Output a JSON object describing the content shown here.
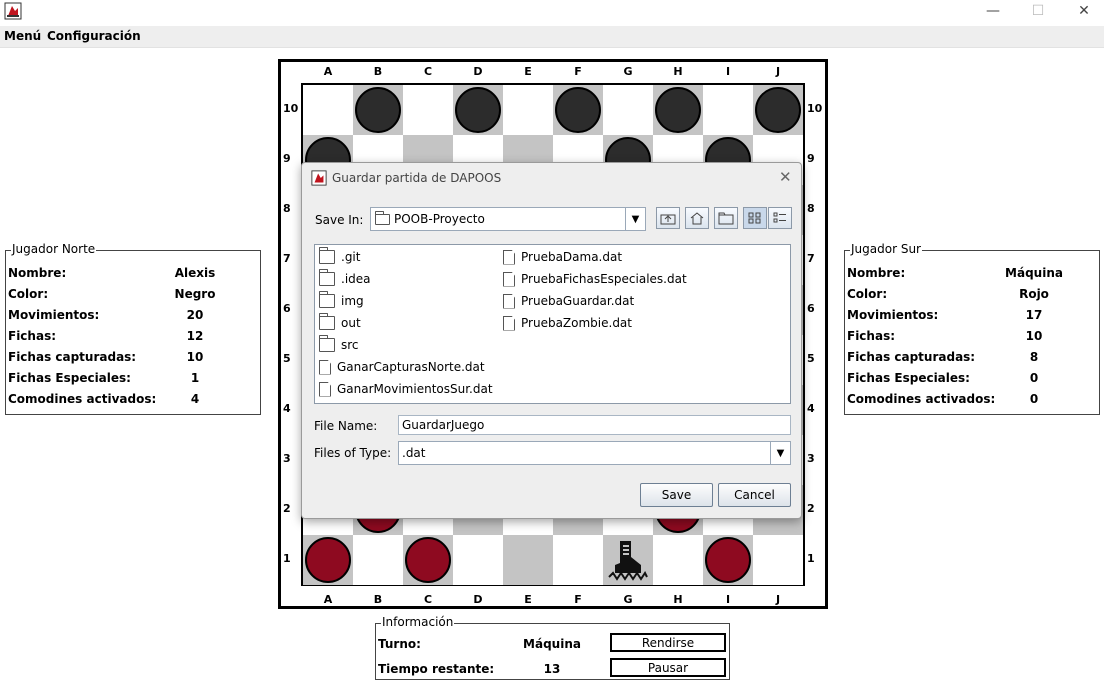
{
  "window": {
    "minimize": "—",
    "maximize": "☐",
    "close": "✕"
  },
  "menubar": {
    "items": [
      "Menú",
      "Configuración"
    ]
  },
  "board": {
    "columns": [
      "A",
      "B",
      "C",
      "D",
      "E",
      "F",
      "G",
      "H",
      "I",
      "J"
    ],
    "rows": [
      "10",
      "9",
      "8",
      "7",
      "6",
      "5",
      "4",
      "3",
      "2",
      "1"
    ],
    "pieces": [
      {
        "row": "10",
        "col": "B",
        "color": "black"
      },
      {
        "row": "10",
        "col": "D",
        "color": "black"
      },
      {
        "row": "10",
        "col": "F",
        "color": "black"
      },
      {
        "row": "10",
        "col": "H",
        "color": "black"
      },
      {
        "row": "10",
        "col": "J",
        "color": "black"
      },
      {
        "row": "9",
        "col": "A",
        "color": "black"
      },
      {
        "row": "9",
        "col": "G",
        "color": "black"
      },
      {
        "row": "9",
        "col": "I",
        "color": "black"
      },
      {
        "row": "2",
        "col": "B",
        "color": "red"
      },
      {
        "row": "2",
        "col": "H",
        "color": "red"
      },
      {
        "row": "1",
        "col": "A",
        "color": "red"
      },
      {
        "row": "1",
        "col": "C",
        "color": "red"
      },
      {
        "row": "1",
        "col": "I",
        "color": "red"
      },
      {
        "row": "1",
        "col": "G",
        "color": "zombie"
      }
    ],
    "colors": {
      "dark_square": "#c4c4c4",
      "black_piece": "#2c2c2c",
      "red_piece": "#8e0a20"
    }
  },
  "dialog": {
    "title": "Guardar partida de DAPOOS",
    "save_in_label": "Save In:",
    "save_in_value": "POOB-Proyecto",
    "files": [
      {
        "name": ".git",
        "type": "folder"
      },
      {
        "name": ".idea",
        "type": "folder"
      },
      {
        "name": "img",
        "type": "folder"
      },
      {
        "name": "out",
        "type": "folder"
      },
      {
        "name": "src",
        "type": "folder"
      },
      {
        "name": "GanarCapturasNorte.dat",
        "type": "file"
      },
      {
        "name": "GanarMovimientosSur.dat",
        "type": "file"
      },
      {
        "name": "PruebaDama.dat",
        "type": "file"
      },
      {
        "name": "PruebaFichasEspeciales.dat",
        "type": "file"
      },
      {
        "name": "PruebaGuardar.dat",
        "type": "file"
      },
      {
        "name": "PruebaZombie.dat",
        "type": "file"
      }
    ],
    "file_name_label": "File Name:",
    "file_name_value": "GuardarJuego",
    "files_of_type_label": "Files of Type:",
    "files_of_type_value": ".dat",
    "save_button": "Save",
    "cancel_button": "Cancel"
  },
  "north": {
    "title": "Jugador Norte",
    "rows": [
      {
        "label": "Nombre:",
        "value": "Alexis"
      },
      {
        "label": "Color:",
        "value": "Negro"
      },
      {
        "label": "Movimientos:",
        "value": "20"
      },
      {
        "label": "Fichas:",
        "value": "12"
      },
      {
        "label": "Fichas capturadas:",
        "value": "10"
      },
      {
        "label": "Fichas Especiales:",
        "value": "1"
      },
      {
        "label": "Comodines activados:",
        "value": "4"
      }
    ]
  },
  "south": {
    "title": "Jugador Sur",
    "rows": [
      {
        "label": "Nombre:",
        "value": "Máquina"
      },
      {
        "label": "Color:",
        "value": "Rojo"
      },
      {
        "label": "Movimientos:",
        "value": "17"
      },
      {
        "label": "Fichas:",
        "value": "10"
      },
      {
        "label": "Fichas capturadas:",
        "value": "8"
      },
      {
        "label": "Fichas Especiales:",
        "value": "0"
      },
      {
        "label": "Comodines activados:",
        "value": "0"
      }
    ]
  },
  "info": {
    "title": "Información",
    "turn_label": "Turno:",
    "turn_value": "Máquina",
    "time_label": "Tiempo restante:",
    "time_value": "13",
    "surrender_button": "Rendirse",
    "pause_button": "Pausar"
  }
}
